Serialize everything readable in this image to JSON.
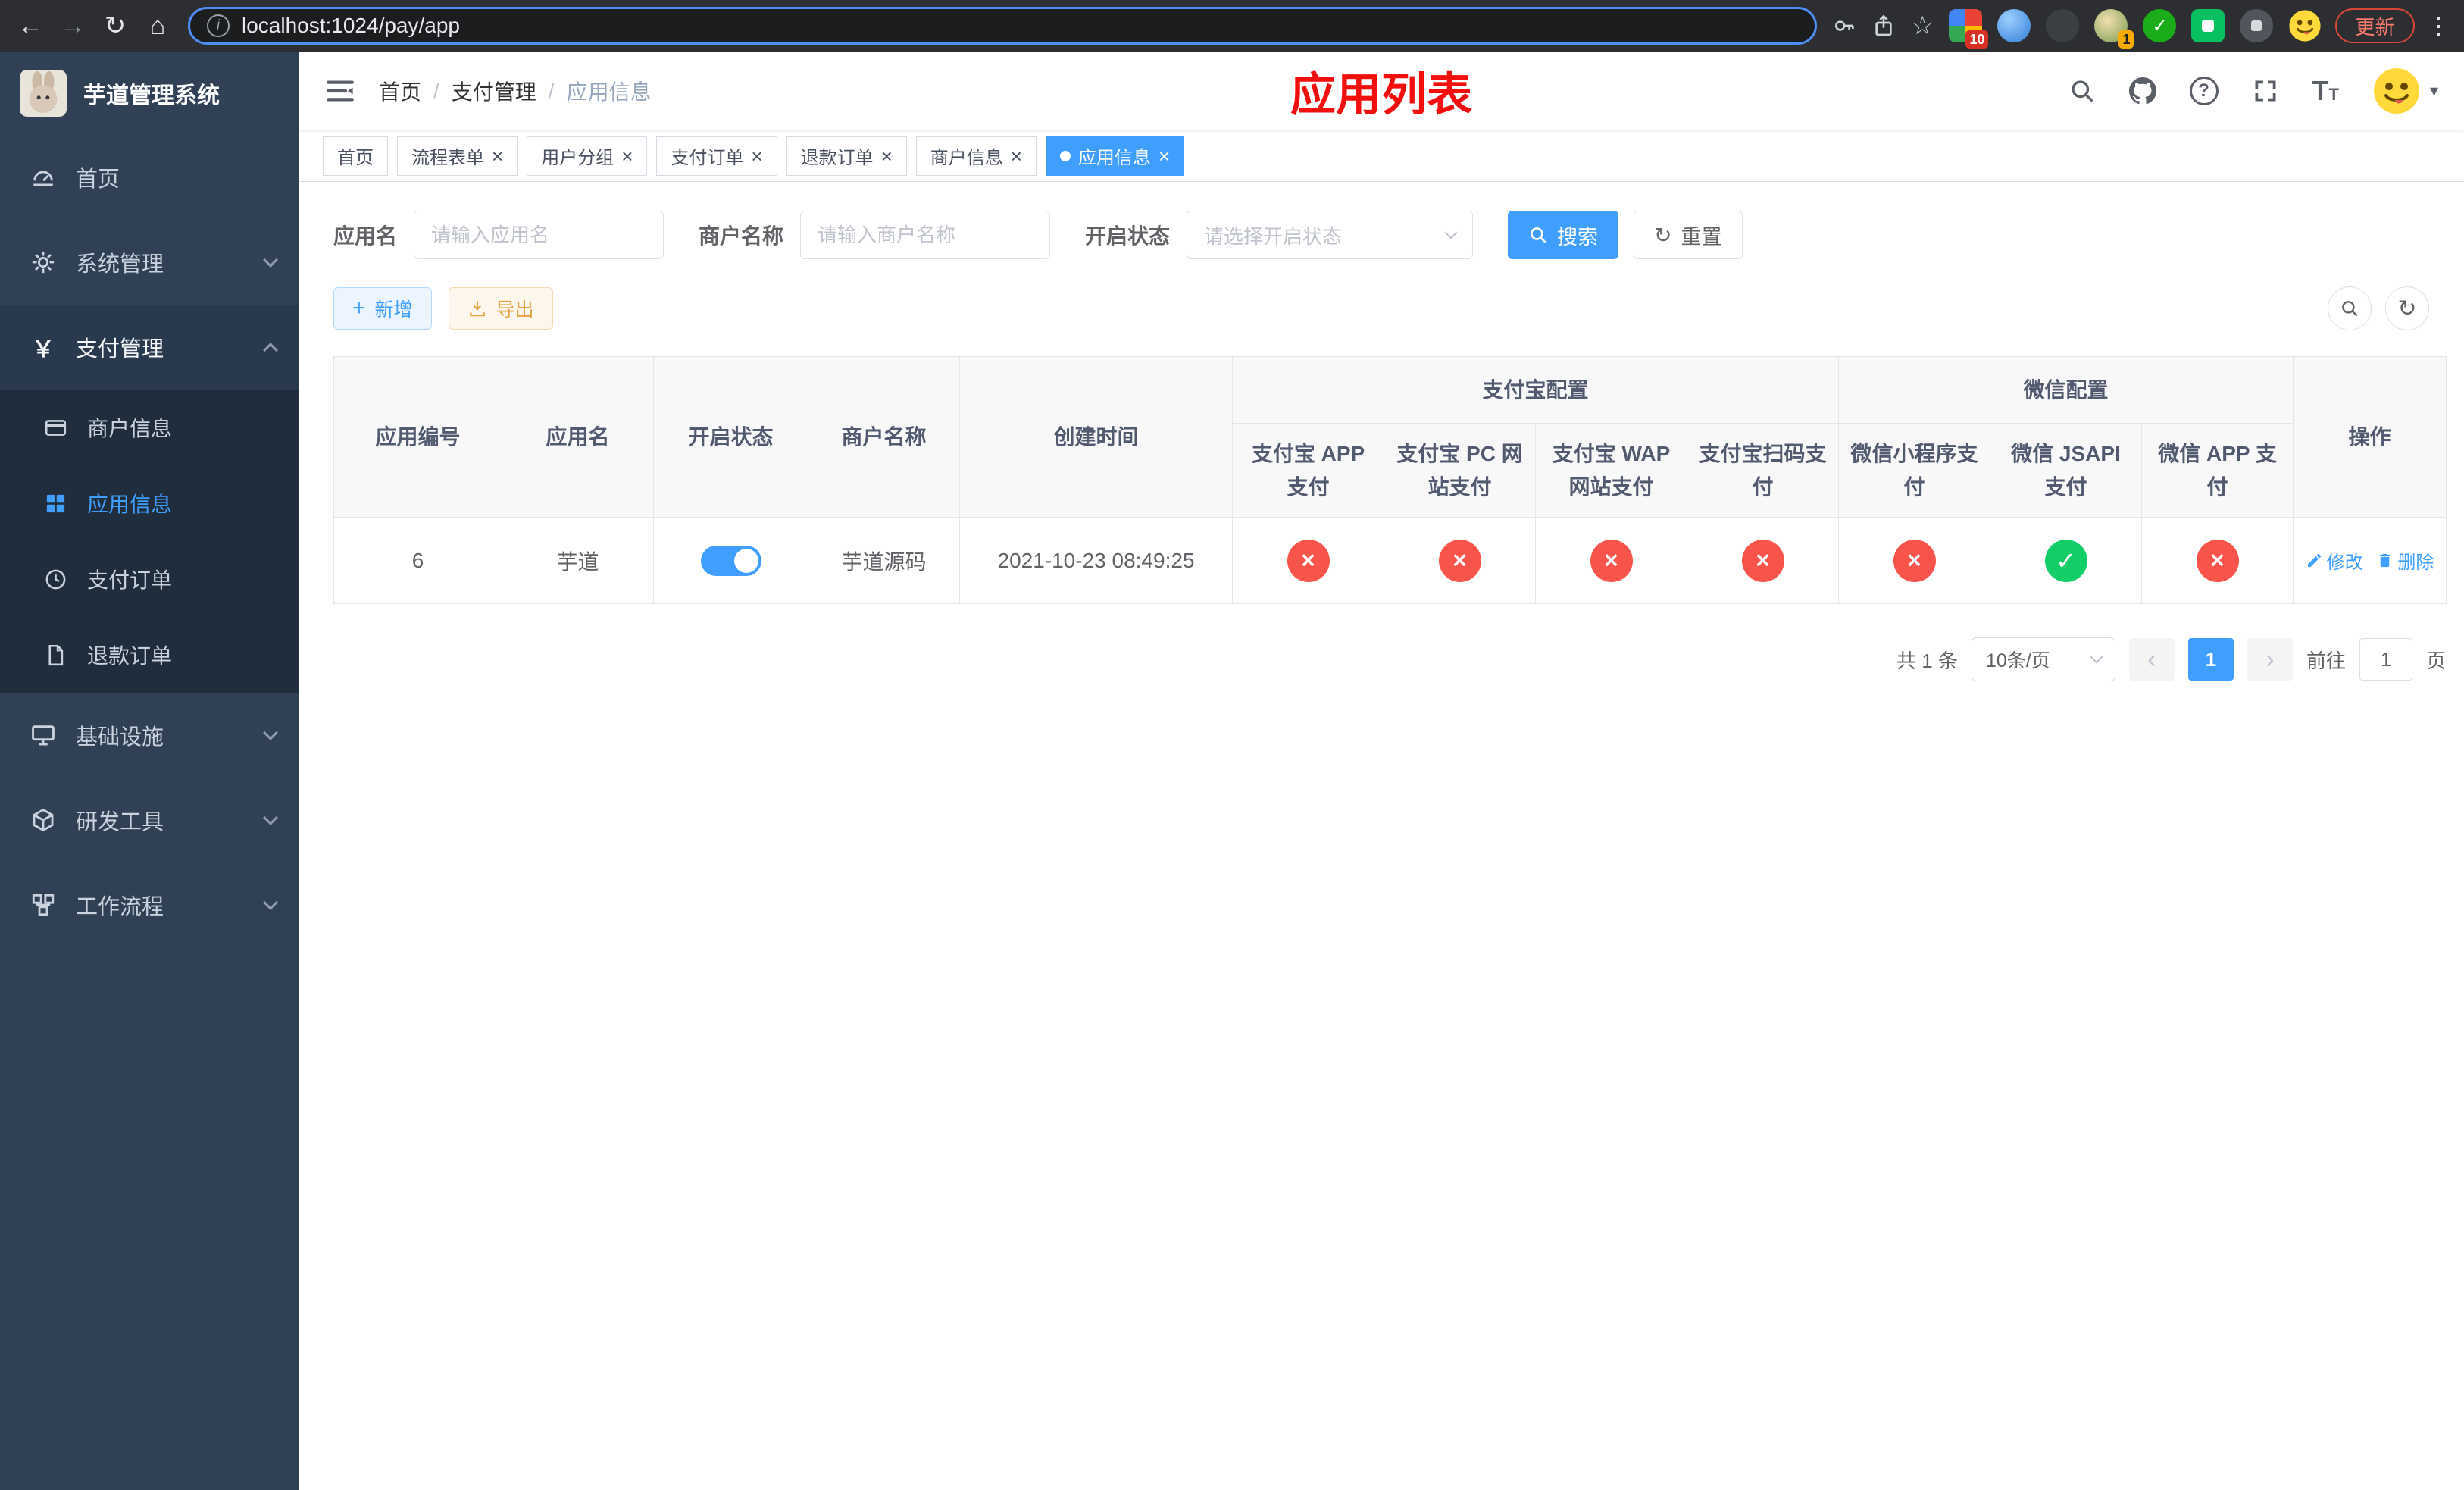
{
  "browser": {
    "url": "localhost:1024/pay/app",
    "update_label": "更新",
    "ext_badge_a": "10",
    "ext_badge_b": "1"
  },
  "sidebar": {
    "logo_title": "芋道管理系统",
    "menu": [
      {
        "label": "首页"
      },
      {
        "label": "系统管理"
      },
      {
        "label": "支付管理"
      },
      {
        "label": "基础设施"
      },
      {
        "label": "研发工具"
      },
      {
        "label": "工作流程"
      }
    ],
    "pay_submenu": [
      {
        "label": "商户信息"
      },
      {
        "label": "应用信息"
      },
      {
        "label": "支付订单"
      },
      {
        "label": "退款订单"
      }
    ]
  },
  "header": {
    "breadcrumb": [
      "首页",
      "支付管理",
      "应用信息"
    ],
    "annotation": "应用列表"
  },
  "tabs": [
    {
      "label": "首页"
    },
    {
      "label": "流程表单"
    },
    {
      "label": "用户分组"
    },
    {
      "label": "支付订单"
    },
    {
      "label": "退款订单"
    },
    {
      "label": "商户信息"
    },
    {
      "label": "应用信息"
    }
  ],
  "filters": {
    "app_name_label": "应用名",
    "app_name_placeholder": "请输入应用名",
    "merchant_label": "商户名称",
    "merchant_placeholder": "请输入商户名称",
    "status_label": "开启状态",
    "status_placeholder": "请选择开启状态",
    "search_label": "搜索",
    "reset_label": "重置"
  },
  "toolbar": {
    "add_label": "新增",
    "export_label": "导出"
  },
  "table": {
    "headers": {
      "app_id": "应用编号",
      "app_name": "应用名",
      "status": "开启状态",
      "merchant": "商户名称",
      "create_time": "创建时间",
      "alipay_group": "支付宝配置",
      "wechat_group": "微信配置",
      "alipay_app": "支付宝 APP 支付",
      "alipay_pc": "支付宝 PC 网站支付",
      "alipay_wap": "支付宝 WAP 网站支付",
      "alipay_qr": "支付宝扫码支付",
      "wx_mini": "微信小程序支付",
      "wx_jsapi": "微信 JSAPI 支付",
      "wx_app": "微信 APP 支付",
      "actions": "操作"
    },
    "rows": [
      {
        "app_id": "6",
        "app_name": "芋道",
        "status": "on",
        "merchant": "芋道源码",
        "create_time": "2021-10-23 08:49:25",
        "alipay_app": "off",
        "alipay_pc": "off",
        "alipay_wap": "off",
        "alipay_qr": "off",
        "wx_mini": "off",
        "wx_jsapi": "on",
        "wx_app": "off",
        "edit_label": "修改",
        "delete_label": "删除"
      }
    ]
  },
  "pagination": {
    "total": "共 1 条",
    "page_size": "10条/页",
    "current_page": "1",
    "goto_label": "前往",
    "goto_value": "1",
    "page_unit": "页"
  },
  "colors": {
    "primary": "#409eff",
    "success": "#13ce66",
    "danger": "#f9544b",
    "annotation_red": "#f40f0f",
    "sidebar_bg": "#304156",
    "sidebar_submenu_bg": "#1f2d3d"
  }
}
